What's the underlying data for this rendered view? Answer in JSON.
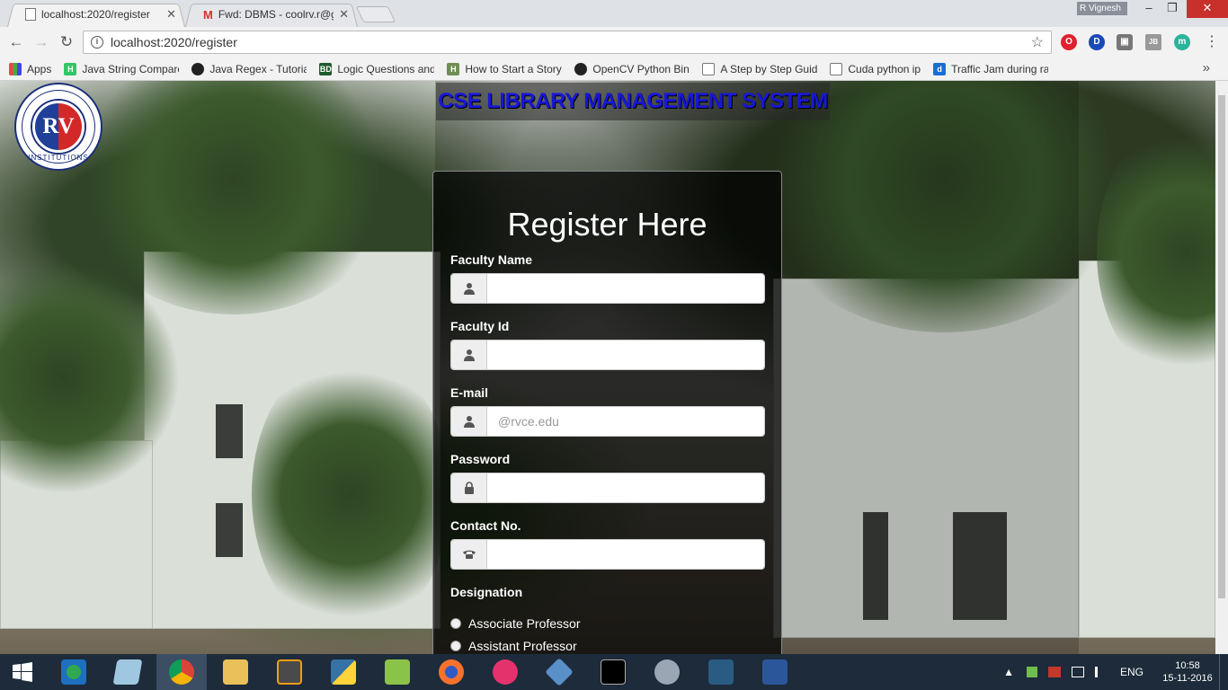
{
  "tabs": [
    {
      "title": "localhost:2020/register",
      "close": "✕",
      "active": true
    },
    {
      "title": "Fwd: DBMS - coolrv.r@gm",
      "close": "✕",
      "active": false
    }
  ],
  "window": {
    "user": "R Vignesh",
    "minimize": "–",
    "maximize": "❐",
    "close": "✕"
  },
  "toolbar": {
    "back": "←",
    "forward": "→",
    "reload": "↻",
    "info": "i",
    "url": "localhost:2020/register",
    "star": "☆",
    "menu": "⋮"
  },
  "extensions": [
    "O",
    "D",
    "▣",
    "JB",
    "m"
  ],
  "bookmarks": [
    {
      "label": "Apps",
      "icon": "apps-grid-icon"
    },
    {
      "label": "Java String Compare",
      "icon": "hackerrank-icon"
    },
    {
      "label": "Java Regex - Tutorial",
      "icon": "vogella-icon"
    },
    {
      "label": "Logic Questions and F",
      "icon": "bd-icon"
    },
    {
      "label": "How to Start a Story:",
      "icon": "h-icon"
    },
    {
      "label": "OpenCV Python Bindi",
      "icon": "github-icon"
    },
    {
      "label": "A Step by Step Guide",
      "icon": "page-icon"
    },
    {
      "label": "Cuda python ip",
      "icon": "page-icon"
    },
    {
      "label": "Traffic Jam during rai",
      "icon": "d-icon"
    }
  ],
  "bookmarks_more": "»",
  "page": {
    "logo_text": "RV",
    "logo_caption": "INSTITUTIONS",
    "banner": "CSE LIBRARY MANAGEMENT SYSTEM",
    "form_title": "Register Here",
    "fields": [
      {
        "label": "Faculty Name",
        "icon": "user-icon",
        "value": "",
        "placeholder": ""
      },
      {
        "label": "Faculty Id",
        "icon": "user-icon",
        "value": "",
        "placeholder": ""
      },
      {
        "label": "E-mail",
        "icon": "user-icon",
        "value": "",
        "placeholder": "@rvce.edu"
      },
      {
        "label": "Password",
        "icon": "lock-icon",
        "value": "",
        "placeholder": ""
      },
      {
        "label": "Contact No.",
        "icon": "phone-icon",
        "value": "",
        "placeholder": ""
      }
    ],
    "designation_label": "Designation",
    "designations": [
      "Associate Professor",
      "Assistant Professor"
    ]
  },
  "taskbar": {
    "lang": "ENG",
    "time": "10:58",
    "date": "15-11-2016"
  },
  "colors": {
    "banner_text": "#1717d8",
    "panel_bg": "rgba(0,0,0,0.72)",
    "taskbar": "#1d2b3a"
  }
}
